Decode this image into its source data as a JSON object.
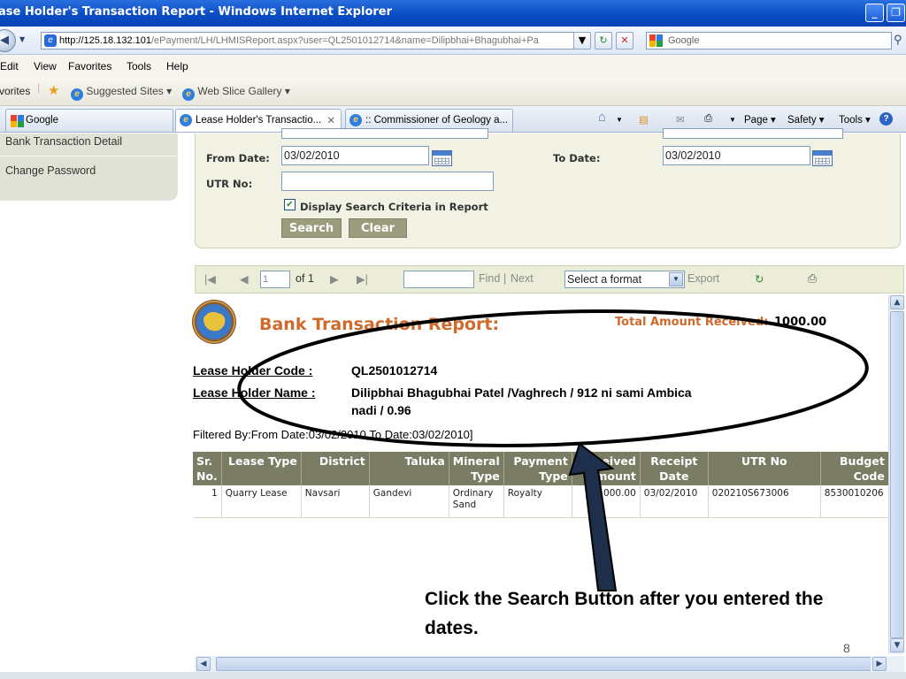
{
  "window": {
    "title": "ase Holder's Transaction Report - Windows Internet Explorer",
    "minimize": "_",
    "restore": "❐"
  },
  "address": {
    "url_host": "http://125.18.132.101",
    "url_path": "/ePayment/LH/LHMISReport.aspx?user=QL2501012714&name=Dilipbhai+Bhagubhai+Pa",
    "search_placeholder": "Google"
  },
  "menu": [
    "Edit",
    "View",
    "Favorites",
    "Tools",
    "Help"
  ],
  "favorites_bar": {
    "label": "vorites",
    "suggested": "Suggested Sites ▾",
    "webslice": "Web Slice Gallery ▾"
  },
  "tabs": [
    {
      "label": "Google"
    },
    {
      "label": "Lease Holder's Transactio...",
      "close": "✕"
    },
    {
      "label": ":: Commissioner of Geology a..."
    }
  ],
  "command_bar": {
    "page": "Page ▾",
    "safety": "Safety ▾",
    "tools": "Tools ▾"
  },
  "sidebar": {
    "items": [
      "Bank Transaction Detail",
      "Change Password"
    ]
  },
  "criteria": {
    "from_label": "From Date:",
    "from_value": "03/02/2010",
    "to_label": "To Date:",
    "to_value": "03/02/2010",
    "utr_label": "UTR No:",
    "utr_value": "",
    "display_checkbox_label": "Display Search Criteria in Report",
    "display_checked": true,
    "search_button": "Search",
    "clear_button": "Clear"
  },
  "report_toolbar": {
    "page_value": "1",
    "of_pages": "of 1",
    "find_link": "Find",
    "separator": "|",
    "next_link": "Next",
    "format_select": "Select a format",
    "export_link": "Export"
  },
  "report": {
    "title": "Bank Transaction Report:",
    "total_label": "Total Amount Received:",
    "total_value": "1000.00",
    "lease_code_label": "Lease Holder Code :",
    "lease_code_value": "QL2501012714",
    "lease_name_label": "Lease Holder Name :",
    "lease_name_line1": "Dilipbhai Bhagubhai Patel /Vaghrech / 912 ni sami Ambica",
    "lease_name_line2": "nadi / 0.96",
    "filter_text": "Filtered By:From Date:03/02/2010,To Date:03/02/2010]",
    "columns": [
      "Sr. No.",
      "Lease Type",
      "District",
      "Taluka",
      "Mineral Type",
      "Payment Type",
      "Received Amount",
      "Receipt Date",
      "UTR No",
      "Budget Code"
    ],
    "rows": [
      [
        "1",
        "Quarry Lease",
        "Navsari",
        "Gandevi",
        "Ordinary Sand",
        "Royalty",
        "1000.00",
        "03/02/2010",
        "020210S673006",
        "8530010206"
      ]
    ]
  },
  "annotation": {
    "line1": "Click the Search Button after you entered  the",
    "line2": "dates.",
    "page_number": "8"
  }
}
